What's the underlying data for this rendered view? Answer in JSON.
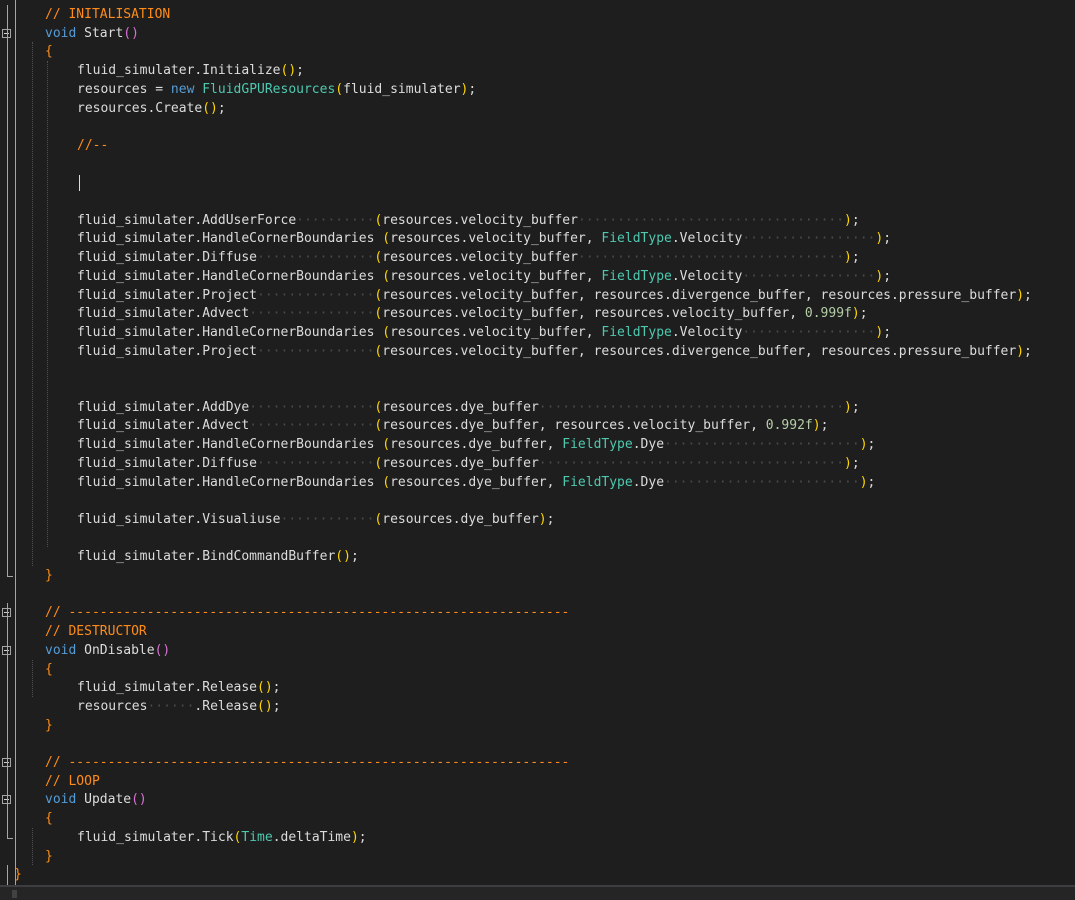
{
  "editor": {
    "language": "C#",
    "colors": {
      "background": "#1e1e1e",
      "comment": "#ff8c1a",
      "keyword": "#569cd6",
      "type": "#4ec9b0",
      "number": "#b5cea8",
      "text": "#dcdcdc",
      "paren_outer": "#ffd700",
      "paren_inner": "#da70d6",
      "brace": "#ff8c1a"
    },
    "lines": [
      {
        "indent": 1,
        "segments": [
          {
            "t": "// INITALISATION",
            "c": "cm"
          }
        ]
      },
      {
        "indent": 1,
        "fold": true,
        "segments": [
          {
            "t": "void",
            "c": "kw"
          },
          {
            "t": " ",
            "c": "ws"
          },
          {
            "t": "Start",
            "c": "mt"
          },
          {
            "t": "()",
            "c": "p2"
          }
        ]
      },
      {
        "indent": 1,
        "segments": [
          {
            "t": "{",
            "c": "br"
          }
        ]
      },
      {
        "indent": 2,
        "segments": [
          {
            "t": "fluid_simulater.Initialize",
            "c": "mt"
          },
          {
            "t": "()",
            "c": "p1"
          },
          {
            "t": ";",
            "c": "mt"
          }
        ]
      },
      {
        "indent": 2,
        "segments": [
          {
            "t": "resources = ",
            "c": "mt"
          },
          {
            "t": "new",
            "c": "kw"
          },
          {
            "t": " ",
            "c": "ws"
          },
          {
            "t": "FluidGPUResources",
            "c": "ty"
          },
          {
            "t": "(",
            "c": "p1"
          },
          {
            "t": "fluid_simulater",
            "c": "mt"
          },
          {
            "t": ")",
            "c": "p1"
          },
          {
            "t": ";",
            "c": "mt"
          }
        ]
      },
      {
        "indent": 2,
        "segments": [
          {
            "t": "resources.Create",
            "c": "mt"
          },
          {
            "t": "()",
            "c": "p1"
          },
          {
            "t": ";",
            "c": "mt"
          }
        ]
      },
      {
        "indent": 0,
        "segments": []
      },
      {
        "indent": 2,
        "segments": [
          {
            "t": "//--",
            "c": "cm"
          }
        ]
      },
      {
        "indent": 0,
        "segments": []
      },
      {
        "indent": 2,
        "segments": [
          {
            "t": "",
            "c": "mt"
          }
        ],
        "cursor": true
      },
      {
        "indent": 0,
        "segments": []
      },
      {
        "indent": 2,
        "segments": [
          {
            "t": "fluid_simulater.AddUserForce",
            "c": "mt"
          },
          {
            "t": "··········",
            "c": "ws"
          },
          {
            "t": "(",
            "c": "p1"
          },
          {
            "t": "resources.velocity_buffer",
            "c": "mt"
          },
          {
            "t": "··································",
            "c": "ws"
          },
          {
            "t": ")",
            "c": "p1"
          },
          {
            "t": ";",
            "c": "mt"
          }
        ]
      },
      {
        "indent": 2,
        "segments": [
          {
            "t": "fluid_simulater.HandleCornerBoundaries",
            "c": "mt"
          },
          {
            "t": " ",
            "c": "ws"
          },
          {
            "t": "(",
            "c": "p1"
          },
          {
            "t": "resources.velocity_buffer, ",
            "c": "mt"
          },
          {
            "t": "FieldType",
            "c": "ty"
          },
          {
            "t": ".Velocity",
            "c": "mt"
          },
          {
            "t": "·················",
            "c": "ws"
          },
          {
            "t": ")",
            "c": "p1"
          },
          {
            "t": ";",
            "c": "mt"
          }
        ]
      },
      {
        "indent": 2,
        "segments": [
          {
            "t": "fluid_simulater.Diffuse",
            "c": "mt"
          },
          {
            "t": "···············",
            "c": "ws"
          },
          {
            "t": "(",
            "c": "p1"
          },
          {
            "t": "resources.velocity_buffer",
            "c": "mt"
          },
          {
            "t": "··································",
            "c": "ws"
          },
          {
            "t": ")",
            "c": "p1"
          },
          {
            "t": ";",
            "c": "mt"
          }
        ]
      },
      {
        "indent": 2,
        "segments": [
          {
            "t": "fluid_simulater.HandleCornerBoundaries",
            "c": "mt"
          },
          {
            "t": " ",
            "c": "ws"
          },
          {
            "t": "(",
            "c": "p1"
          },
          {
            "t": "resources.velocity_buffer, ",
            "c": "mt"
          },
          {
            "t": "FieldType",
            "c": "ty"
          },
          {
            "t": ".Velocity",
            "c": "mt"
          },
          {
            "t": "·················",
            "c": "ws"
          },
          {
            "t": ")",
            "c": "p1"
          },
          {
            "t": ";",
            "c": "mt"
          }
        ]
      },
      {
        "indent": 2,
        "segments": [
          {
            "t": "fluid_simulater.Project",
            "c": "mt"
          },
          {
            "t": "···············",
            "c": "ws"
          },
          {
            "t": "(",
            "c": "p1"
          },
          {
            "t": "resources.velocity_buffer, resources.divergence_buffer, resources.pressure_buffer",
            "c": "mt"
          },
          {
            "t": ")",
            "c": "p1"
          },
          {
            "t": ";",
            "c": "mt"
          }
        ]
      },
      {
        "indent": 2,
        "segments": [
          {
            "t": "fluid_simulater.Advect",
            "c": "mt"
          },
          {
            "t": "················",
            "c": "ws"
          },
          {
            "t": "(",
            "c": "p1"
          },
          {
            "t": "resources.velocity_buffer, resources.velocity_buffer, ",
            "c": "mt"
          },
          {
            "t": "0.999f",
            "c": "nm"
          },
          {
            "t": ")",
            "c": "p1"
          },
          {
            "t": ";",
            "c": "mt"
          }
        ]
      },
      {
        "indent": 2,
        "segments": [
          {
            "t": "fluid_simulater.HandleCornerBoundaries",
            "c": "mt"
          },
          {
            "t": " ",
            "c": "ws"
          },
          {
            "t": "(",
            "c": "p1"
          },
          {
            "t": "resources.velocity_buffer, ",
            "c": "mt"
          },
          {
            "t": "FieldType",
            "c": "ty"
          },
          {
            "t": ".Velocity",
            "c": "mt"
          },
          {
            "t": "·················",
            "c": "ws"
          },
          {
            "t": ")",
            "c": "p1"
          },
          {
            "t": ";",
            "c": "mt"
          }
        ]
      },
      {
        "indent": 2,
        "segments": [
          {
            "t": "fluid_simulater.Project",
            "c": "mt"
          },
          {
            "t": "···············",
            "c": "ws"
          },
          {
            "t": "(",
            "c": "p1"
          },
          {
            "t": "resources.velocity_buffer, resources.divergence_buffer, resources.pressure_buffer",
            "c": "mt"
          },
          {
            "t": ")",
            "c": "p1"
          },
          {
            "t": ";",
            "c": "mt"
          }
        ]
      },
      {
        "indent": 0,
        "segments": []
      },
      {
        "indent": 0,
        "segments": []
      },
      {
        "indent": 2,
        "segments": [
          {
            "t": "fluid_simulater.AddDye",
            "c": "mt"
          },
          {
            "t": "················",
            "c": "ws"
          },
          {
            "t": "(",
            "c": "p1"
          },
          {
            "t": "resources.dye_buffer",
            "c": "mt"
          },
          {
            "t": "·······································",
            "c": "ws"
          },
          {
            "t": ")",
            "c": "p1"
          },
          {
            "t": ";",
            "c": "mt"
          }
        ]
      },
      {
        "indent": 2,
        "segments": [
          {
            "t": "fluid_simulater.Advect",
            "c": "mt"
          },
          {
            "t": "················",
            "c": "ws"
          },
          {
            "t": "(",
            "c": "p1"
          },
          {
            "t": "resources.dye_buffer, resources.velocity_buffer, ",
            "c": "mt"
          },
          {
            "t": "0.992f",
            "c": "nm"
          },
          {
            "t": ")",
            "c": "p1"
          },
          {
            "t": ";",
            "c": "mt"
          }
        ]
      },
      {
        "indent": 2,
        "segments": [
          {
            "t": "fluid_simulater.HandleCornerBoundaries",
            "c": "mt"
          },
          {
            "t": " ",
            "c": "ws"
          },
          {
            "t": "(",
            "c": "p1"
          },
          {
            "t": "resources.dye_buffer, ",
            "c": "mt"
          },
          {
            "t": "FieldType",
            "c": "ty"
          },
          {
            "t": ".Dye",
            "c": "mt"
          },
          {
            "t": "·························",
            "c": "ws"
          },
          {
            "t": ")",
            "c": "p1"
          },
          {
            "t": ";",
            "c": "mt"
          }
        ]
      },
      {
        "indent": 2,
        "segments": [
          {
            "t": "fluid_simulater.Diffuse",
            "c": "mt"
          },
          {
            "t": "···············",
            "c": "ws"
          },
          {
            "t": "(",
            "c": "p1"
          },
          {
            "t": "resources.dye_buffer",
            "c": "mt"
          },
          {
            "t": "·······································",
            "c": "ws"
          },
          {
            "t": ")",
            "c": "p1"
          },
          {
            "t": ";",
            "c": "mt"
          }
        ]
      },
      {
        "indent": 2,
        "segments": [
          {
            "t": "fluid_simulater.HandleCornerBoundaries",
            "c": "mt"
          },
          {
            "t": " ",
            "c": "ws"
          },
          {
            "t": "(",
            "c": "p1"
          },
          {
            "t": "resources.dye_buffer, ",
            "c": "mt"
          },
          {
            "t": "FieldType",
            "c": "ty"
          },
          {
            "t": ".Dye",
            "c": "mt"
          },
          {
            "t": "·························",
            "c": "ws"
          },
          {
            "t": ")",
            "c": "p1"
          },
          {
            "t": ";",
            "c": "mt"
          }
        ]
      },
      {
        "indent": 0,
        "segments": []
      },
      {
        "indent": 2,
        "segments": [
          {
            "t": "fluid_simulater.Visualiuse",
            "c": "mt"
          },
          {
            "t": "············",
            "c": "ws"
          },
          {
            "t": "(",
            "c": "p1"
          },
          {
            "t": "resources.dye_buffer",
            "c": "mt"
          },
          {
            "t": ")",
            "c": "p1"
          },
          {
            "t": ";",
            "c": "mt"
          }
        ]
      },
      {
        "indent": 0,
        "segments": []
      },
      {
        "indent": 2,
        "segments": [
          {
            "t": "fluid_simulater.BindCommandBuffer",
            "c": "mt"
          },
          {
            "t": "()",
            "c": "p1"
          },
          {
            "t": ";",
            "c": "mt"
          }
        ]
      },
      {
        "indent": 1,
        "segments": [
          {
            "t": "}",
            "c": "br"
          }
        ]
      },
      {
        "indent": 0,
        "segments": []
      },
      {
        "indent": 1,
        "fold": true,
        "segments": [
          {
            "t": "// ----------------------------------------------------------------",
            "c": "cm"
          }
        ]
      },
      {
        "indent": 1,
        "segments": [
          {
            "t": "// DESTRUCTOR",
            "c": "cm"
          }
        ]
      },
      {
        "indent": 1,
        "fold": true,
        "segments": [
          {
            "t": "void",
            "c": "kw"
          },
          {
            "t": " ",
            "c": "ws"
          },
          {
            "t": "OnDisable",
            "c": "mt"
          },
          {
            "t": "()",
            "c": "p2"
          }
        ]
      },
      {
        "indent": 1,
        "segments": [
          {
            "t": "{",
            "c": "br"
          }
        ]
      },
      {
        "indent": 2,
        "segments": [
          {
            "t": "fluid_simulater.Release",
            "c": "mt"
          },
          {
            "t": "()",
            "c": "p1"
          },
          {
            "t": ";",
            "c": "mt"
          }
        ]
      },
      {
        "indent": 2,
        "segments": [
          {
            "t": "resources",
            "c": "mt"
          },
          {
            "t": "······",
            "c": "ws"
          },
          {
            "t": ".Release",
            "c": "mt"
          },
          {
            "t": "()",
            "c": "p1"
          },
          {
            "t": ";",
            "c": "mt"
          }
        ]
      },
      {
        "indent": 1,
        "segments": [
          {
            "t": "}",
            "c": "br"
          }
        ]
      },
      {
        "indent": 0,
        "segments": []
      },
      {
        "indent": 1,
        "fold": true,
        "segments": [
          {
            "t": "// ----------------------------------------------------------------",
            "c": "cm"
          }
        ]
      },
      {
        "indent": 1,
        "segments": [
          {
            "t": "// LOOP",
            "c": "cm"
          }
        ]
      },
      {
        "indent": 1,
        "fold": true,
        "segments": [
          {
            "t": "void",
            "c": "kw"
          },
          {
            "t": " ",
            "c": "ws"
          },
          {
            "t": "Update",
            "c": "mt"
          },
          {
            "t": "()",
            "c": "p2"
          }
        ]
      },
      {
        "indent": 1,
        "segments": [
          {
            "t": "{",
            "c": "br"
          }
        ]
      },
      {
        "indent": 2,
        "segments": [
          {
            "t": "fluid_simulater.Tick",
            "c": "mt"
          },
          {
            "t": "(",
            "c": "p1"
          },
          {
            "t": "Time",
            "c": "ty"
          },
          {
            "t": ".deltaTime",
            "c": "mt"
          },
          {
            "t": ")",
            "c": "p1"
          },
          {
            "t": ";",
            "c": "mt"
          }
        ]
      },
      {
        "indent": 1,
        "segments": [
          {
            "t": "}",
            "c": "br"
          }
        ]
      },
      {
        "indent": 0,
        "segments": [
          {
            "t": "}",
            "c": "br"
          }
        ]
      }
    ]
  }
}
